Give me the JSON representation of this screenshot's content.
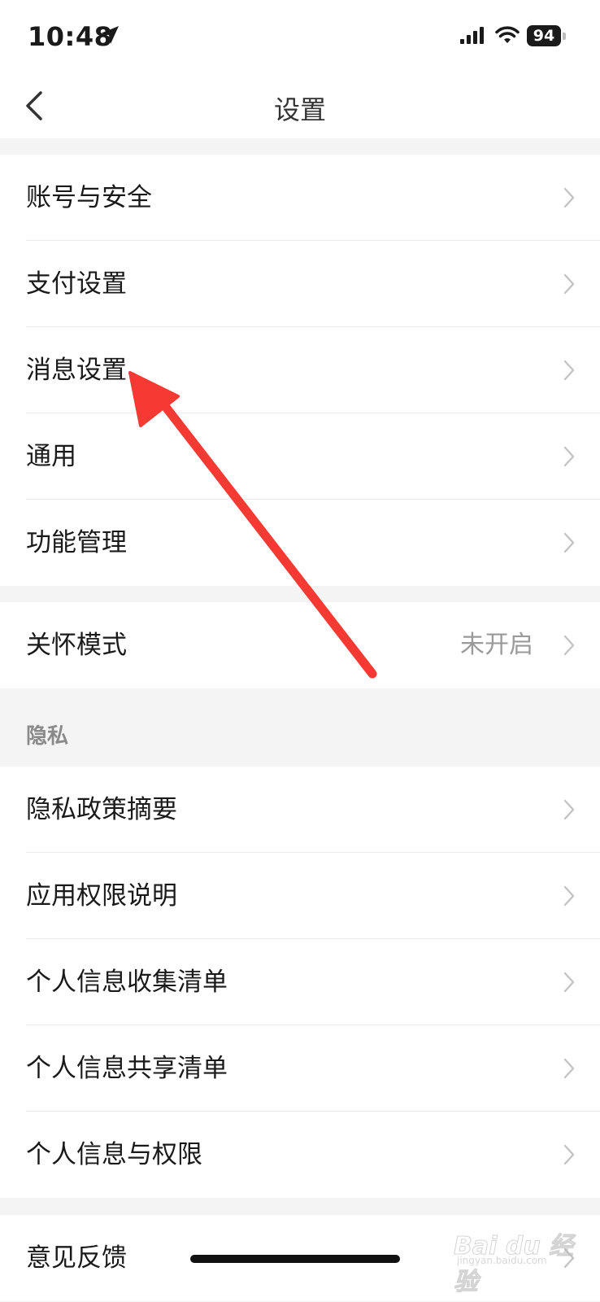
{
  "status_bar": {
    "time": "10:48",
    "battery": "94",
    "icons": [
      "location-arrow-icon",
      "signal-icon",
      "wifi-icon",
      "battery-icon"
    ]
  },
  "nav": {
    "title": "设置",
    "back_icon": "chevron-left-icon"
  },
  "group1": [
    {
      "label": "账号与安全"
    },
    {
      "label": "支付设置"
    },
    {
      "label": "消息设置"
    },
    {
      "label": "通用"
    },
    {
      "label": "功能管理"
    }
  ],
  "group2": [
    {
      "label": "关怀模式",
      "value": "未开启"
    }
  ],
  "privacy": {
    "title": "隐私",
    "items": [
      {
        "label": "隐私政策摘要"
      },
      {
        "label": "应用权限说明"
      },
      {
        "label": "个人信息收集清单"
      },
      {
        "label": "个人信息共享清单"
      },
      {
        "label": "个人信息与权限"
      }
    ]
  },
  "group4": [
    {
      "label": "意见反馈"
    }
  ],
  "watermark": {
    "text": "Bai du 经验",
    "sub": "jingyan.baidu.com"
  },
  "colors": {
    "background": "#f4f4f4",
    "card": "#ffffff",
    "annotation_arrow": "#f43a33",
    "secondary_text": "#9a9a9a"
  }
}
